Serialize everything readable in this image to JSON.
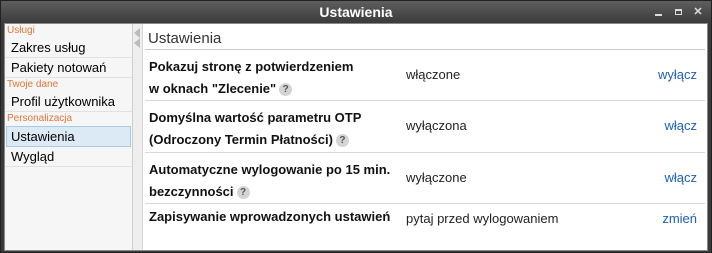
{
  "window": {
    "title": "Ustawienia"
  },
  "sidebar": {
    "groups": [
      {
        "label": "Usługi",
        "items": [
          {
            "label": "Zakres usług"
          },
          {
            "label": "Pakiety notowań"
          }
        ]
      },
      {
        "label": "Twoje dane",
        "items": [
          {
            "label": "Profil użytkownika"
          }
        ]
      },
      {
        "label": "Personalizacja",
        "items": [
          {
            "label": "Ustawienia",
            "active": true
          },
          {
            "label": "Wygląd"
          }
        ]
      }
    ]
  },
  "main": {
    "title": "Ustawienia",
    "settings": [
      {
        "label_line1": "Pokazuj stronę z potwierdzeniem",
        "label_line2": "w oknach \"Zlecenie\"",
        "value": "włączone",
        "action": "wyłącz"
      },
      {
        "label_line1": "Domyślna wartość parametru OTP",
        "label_line2": "(Odroczony Termin Płatności)",
        "value": "wyłączona",
        "action": "włącz"
      },
      {
        "label_line1": "Automatyczne wylogowanie po 15 min.",
        "label_line2": "bezczynności",
        "value": "wyłączone",
        "action": "włącz"
      },
      {
        "label_line1": "Zapisywanie wprowadzonych ustawień",
        "value": "pytaj przed wylogowaniem",
        "action": "zmień"
      }
    ],
    "help_glyph": "?"
  },
  "colors": {
    "group_label": "#e0763a",
    "link": "#1d5fb8",
    "active_item_bg": "#dbeaf5"
  }
}
